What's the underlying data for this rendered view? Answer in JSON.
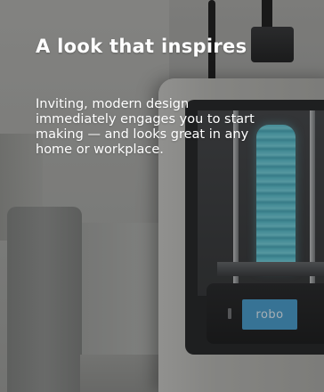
{
  "feature": {
    "title": "A look that inspires",
    "description": "Inviting, modern design immediately engages you to start making — and looks great in any home or workplace."
  },
  "image": {
    "printer_screen_text": "robo"
  },
  "colors": {
    "text": "#ffffff",
    "printer_screen": "#3f9bd0",
    "printed_object": "#56c3d3"
  }
}
